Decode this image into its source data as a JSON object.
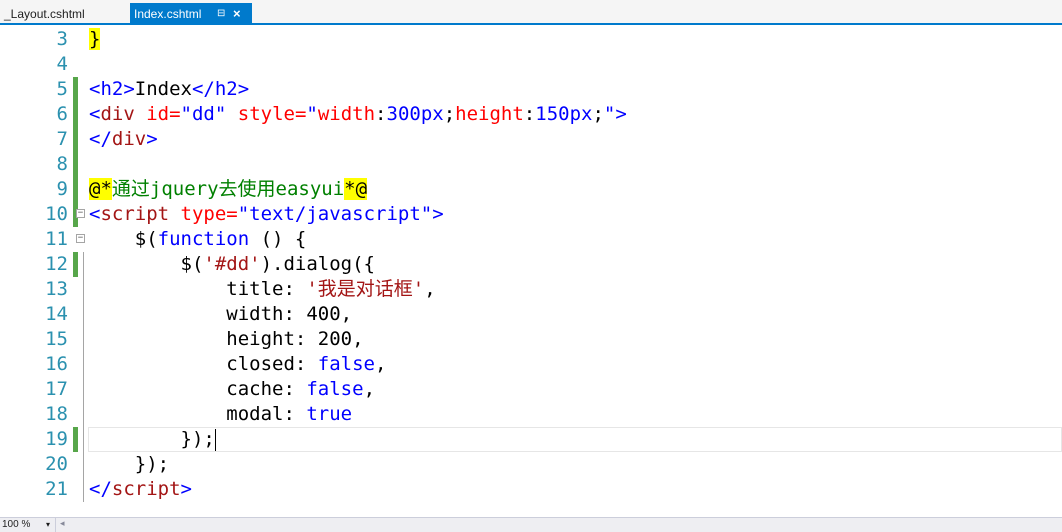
{
  "tabs": [
    {
      "label": "_Layout.cshtml",
      "active": false
    },
    {
      "label": "Index.cshtml",
      "active": true,
      "pin_glyph": "⊟",
      "close_glyph": "×"
    }
  ],
  "editor": {
    "line_numbers": [
      "3",
      "4",
      "5",
      "6",
      "7",
      "8",
      "9",
      "10",
      "11",
      "12",
      "13",
      "14",
      "15",
      "16",
      "17",
      "18",
      "19",
      "20",
      "21"
    ],
    "lines": {
      "l3": {
        "brace": "}"
      },
      "l5": {
        "open": "<h2>",
        "text": "Index",
        "close": "</h2>"
      },
      "l6": {
        "lt": "<",
        "tag": "div",
        "attr1": " id=",
        "val1": "\"dd\"",
        "attr2": " style=",
        "q1": "\"",
        "p1": "width",
        "c1": ":",
        "v1": "300px",
        "s1": ";",
        "p2": "height",
        "c2": ":",
        "v2": "150px",
        "s2": ";",
        "q2": "\"",
        "gt": ">"
      },
      "l7": {
        "lt": "</",
        "tag": "div",
        "gt": ">"
      },
      "l9": {
        "start": "@*",
        "comment": "通过jquery去使用easyui",
        "end": "*@"
      },
      "l10": {
        "lt": "<",
        "tag": "script",
        "attr": " type=",
        "val": "\"text/javascript\"",
        "gt": ">"
      },
      "l11": {
        "indent": "    ",
        "pre": "$(",
        "kw": "function",
        "post": " () {"
      },
      "l12": {
        "indent": "        ",
        "pre": "$(",
        "str": "'#dd'",
        "post": ").dialog({"
      },
      "l13": {
        "indent": "            ",
        "key": "title: ",
        "str": "'我是对话框'",
        "post": ","
      },
      "l14": {
        "indent": "            ",
        "text": "width: 400,"
      },
      "l15": {
        "indent": "            ",
        "text": "height: 200,"
      },
      "l16": {
        "indent": "            ",
        "key": "closed: ",
        "kw": "false",
        "post": ","
      },
      "l17": {
        "indent": "            ",
        "key": "cache: ",
        "kw": "false",
        "post": ","
      },
      "l18": {
        "indent": "            ",
        "key": "modal: ",
        "kw": "true"
      },
      "l19": {
        "indent": "        ",
        "text": "});"
      },
      "l20": {
        "indent": "    ",
        "text": "});"
      },
      "l21": {
        "lt": "</",
        "tag": "script",
        "gt": ">"
      }
    }
  },
  "status": {
    "zoom": "100 %",
    "zoom_arrow": "▾",
    "scroll_left": "◂"
  }
}
